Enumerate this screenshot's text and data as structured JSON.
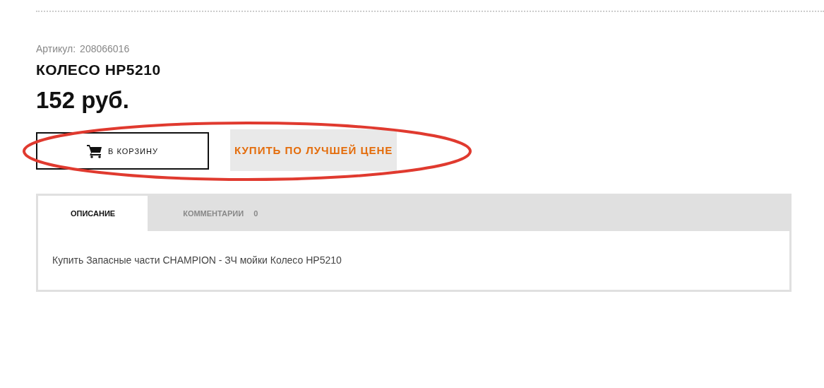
{
  "product": {
    "sku_label": "Артикул:",
    "sku": "208066016",
    "title": "КОЛЕСО HP5210",
    "price": "152 руб."
  },
  "buttons": {
    "cart": "В КОРЗИНУ",
    "best_price": "КУПИТЬ ПО ЛУЧШЕЙ ЦЕНЕ"
  },
  "annotation": {
    "kind": "ellipse"
  },
  "tabs": [
    {
      "label": "ОПИСАНИЕ",
      "selected": true
    },
    {
      "label": "КОММЕНТАРИИ",
      "count": "0",
      "selected": false
    }
  ],
  "description": "Купить Запасные части CHAMPION - ЗЧ мойки Колесо HP5210"
}
